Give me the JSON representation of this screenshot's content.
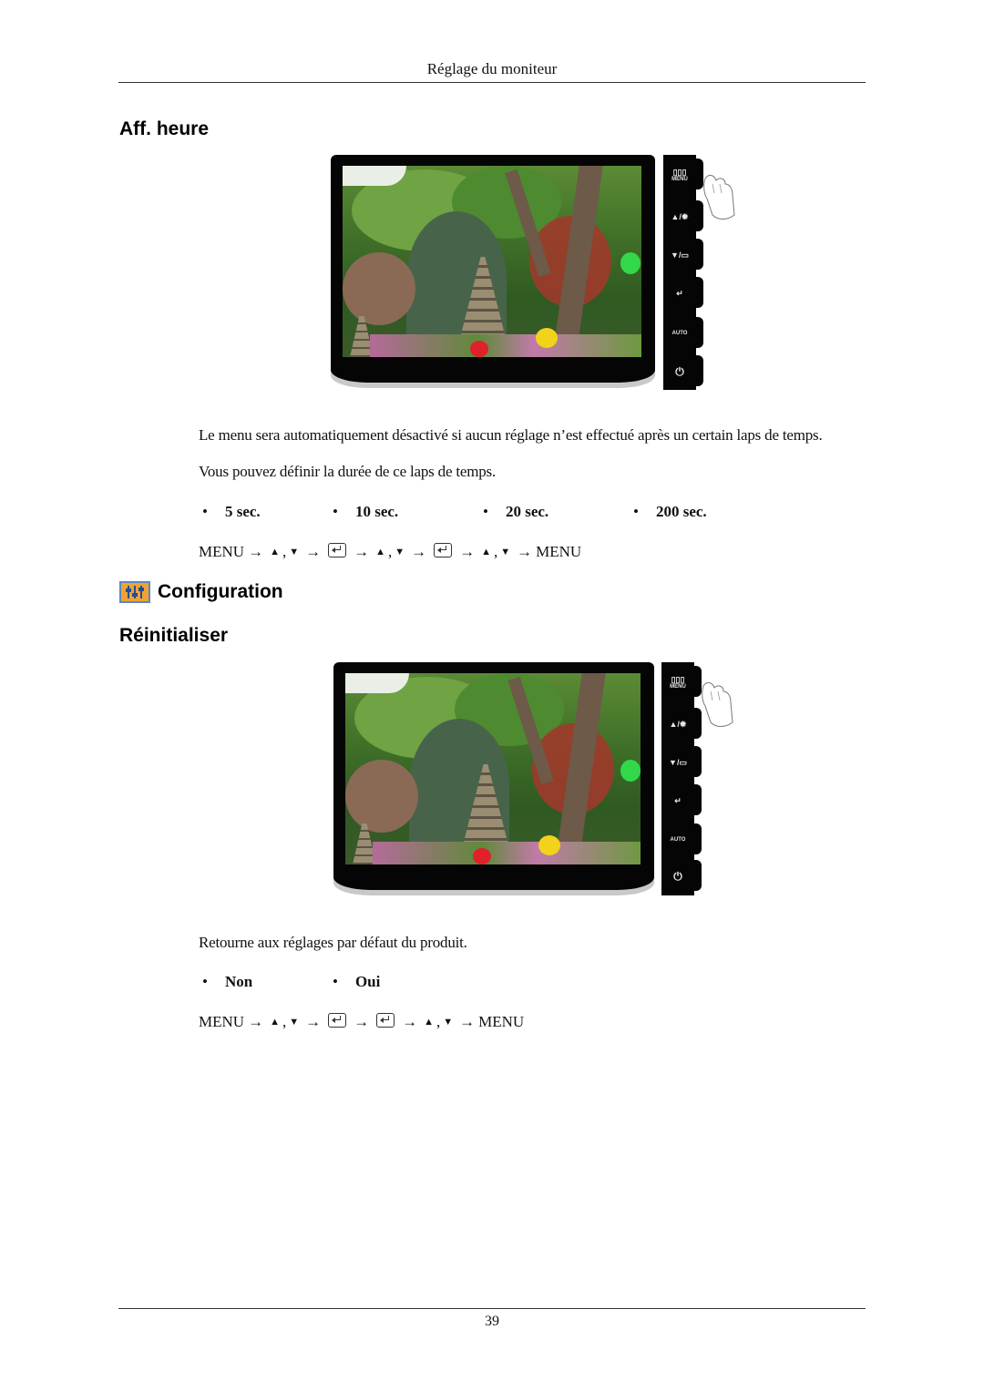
{
  "header": {
    "title": "Réglage du moniteur"
  },
  "sections": {
    "aff_heure": {
      "title": "Aff. heure",
      "description_lines": [
        "Le menu sera automatiquement désactivé si aucun réglage n’est effectué après un certain laps de temps.",
        "Vous pouvez définir la durée de ce laps de temps."
      ],
      "options": [
        "5 sec.",
        "10 sec.",
        "20 sec.",
        "200 sec."
      ],
      "sequence": {
        "start": "MENU",
        "end": "MENU",
        "comma": ","
      }
    },
    "configuration": {
      "title": "Configuration",
      "icon": "settings-sliders-icon"
    },
    "reinitialiser": {
      "title": "Réinitialiser",
      "description": "Retourne aux réglages par défaut du produit.",
      "options": [
        "Non",
        "Oui"
      ],
      "sequence": {
        "start": "MENU",
        "end": "MENU",
        "comma": ","
      }
    }
  },
  "monitor_panel": {
    "buttons": [
      {
        "label": "MENU",
        "icon": "menu-icon",
        "glyph": "▯▯▯"
      },
      {
        "label": "",
        "icon": "up-brightness-icon",
        "glyph": "▲/✹"
      },
      {
        "label": "",
        "icon": "down-source-icon",
        "glyph": "▼/▭"
      },
      {
        "label": "",
        "icon": "enter-icon",
        "glyph": "↵"
      },
      {
        "label": "AUTO",
        "icon": "auto-icon",
        "glyph": ""
      },
      {
        "label": "",
        "icon": "power-icon",
        "glyph": "⏻"
      }
    ]
  },
  "symbols": {
    "arrow": "→",
    "up": "▲",
    "down": "▼",
    "bullet": "•"
  },
  "footer": {
    "page_number": "39"
  }
}
